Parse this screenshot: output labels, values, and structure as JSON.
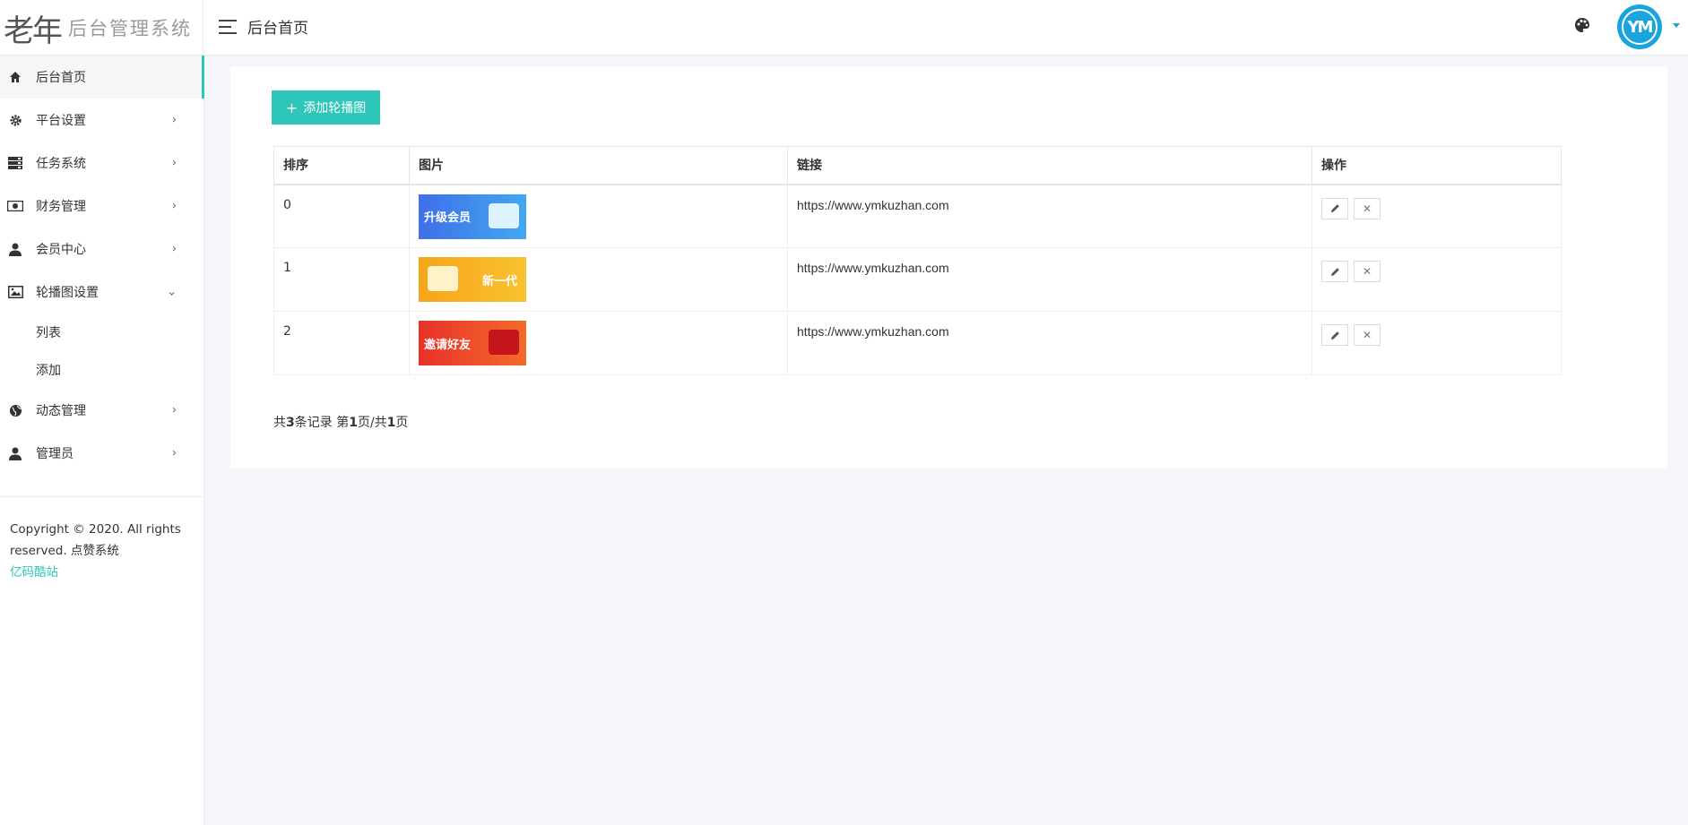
{
  "header": {
    "logo_mark": "老年",
    "logo_text": "后台管理系统",
    "title": "后台首页",
    "avatar_text": "YM"
  },
  "sidebar": {
    "items": [
      {
        "label": "后台首页",
        "icon": "home-icon",
        "arrow": ""
      },
      {
        "label": "平台设置",
        "icon": "gear-icon",
        "arrow": "›"
      },
      {
        "label": "任务系统",
        "icon": "server-icon",
        "arrow": "›"
      },
      {
        "label": "财务管理",
        "icon": "money-icon",
        "arrow": "›"
      },
      {
        "label": "会员中心",
        "icon": "user-icon",
        "arrow": "›"
      },
      {
        "label": "轮播图设置",
        "icon": "image-icon",
        "arrow": "⌄"
      },
      {
        "label": "动态管理",
        "icon": "globe-icon",
        "arrow": "›"
      },
      {
        "label": "管理员",
        "icon": "admin-user-icon",
        "arrow": "›"
      }
    ],
    "sub_items": [
      "列表",
      "添加"
    ],
    "copyright": "Copyright © 2020. All rights reserved. 点赞系统",
    "footer_link": "亿码酷站"
  },
  "main": {
    "add_button": "添加轮播图",
    "columns": [
      "排序",
      "图片",
      "链接",
      "操作"
    ],
    "rows": [
      {
        "order": "0",
        "image_text": "升级会员",
        "link": "https://www.ymkuzhan.com"
      },
      {
        "order": "1",
        "image_text": "新一代",
        "link": "https://www.ymkuzhan.com"
      },
      {
        "order": "2",
        "image_text": "邀请好友",
        "link": "https://www.ymkuzhan.com"
      }
    ],
    "pager": {
      "prefix": "共",
      "total": "3",
      "mid1": "条记录 第",
      "page": "1",
      "mid2": "页/共",
      "pages": "1",
      "suffix": "页"
    }
  },
  "colors": {
    "accent": "#2ec6b8",
    "avatar": "#1aa4dd"
  }
}
